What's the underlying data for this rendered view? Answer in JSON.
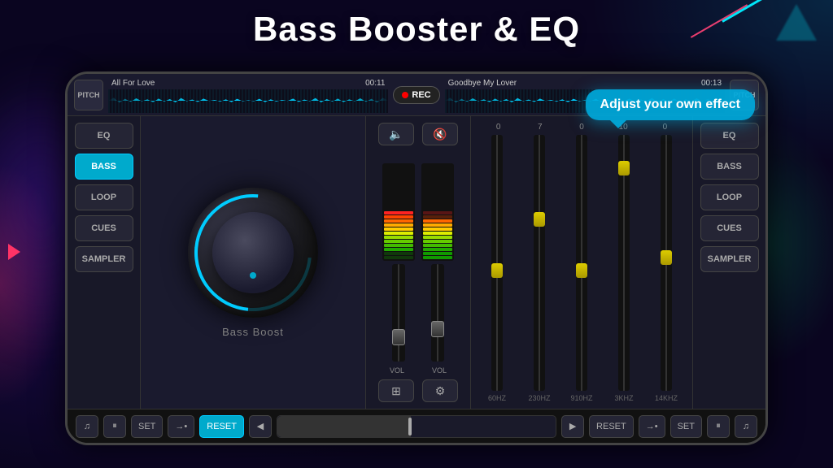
{
  "page": {
    "title": "Bass Booster & EQ"
  },
  "tooltip": {
    "text": "Adjust your own effect"
  },
  "waveform": {
    "left_track": "All For Love",
    "left_time": "00:11",
    "right_track": "Goodbye My Lover",
    "right_time": "00:13",
    "rec_label": "REC"
  },
  "left_panel": {
    "buttons": [
      {
        "label": "EQ",
        "active": false
      },
      {
        "label": "BASS",
        "active": true
      },
      {
        "label": "LOOP",
        "active": false
      },
      {
        "label": "CUES",
        "active": false
      },
      {
        "label": "SAMPLER",
        "active": false
      }
    ]
  },
  "right_panel": {
    "buttons": [
      {
        "label": "EQ",
        "active": false
      },
      {
        "label": "BASS",
        "active": false
      },
      {
        "label": "LOOP",
        "active": false
      },
      {
        "label": "CUES",
        "active": false
      },
      {
        "label": "SAMPLER",
        "active": false
      }
    ]
  },
  "knob": {
    "label": "Bass Boost"
  },
  "eq": {
    "values": [
      "0",
      "7",
      "0",
      "10",
      "0"
    ],
    "freqs": [
      "60HZ",
      "230HZ",
      "910HZ",
      "3KHZ",
      "14KHZ"
    ],
    "positions": [
      50,
      35,
      50,
      15,
      45
    ]
  },
  "bottom_bar": {
    "left_buttons": [
      "♫",
      "⏸",
      "SET",
      "→•",
      "RESET"
    ],
    "right_buttons": [
      "RESET",
      "→•",
      "SET",
      "⏸",
      "♫"
    ]
  },
  "vol_label": "VOL"
}
